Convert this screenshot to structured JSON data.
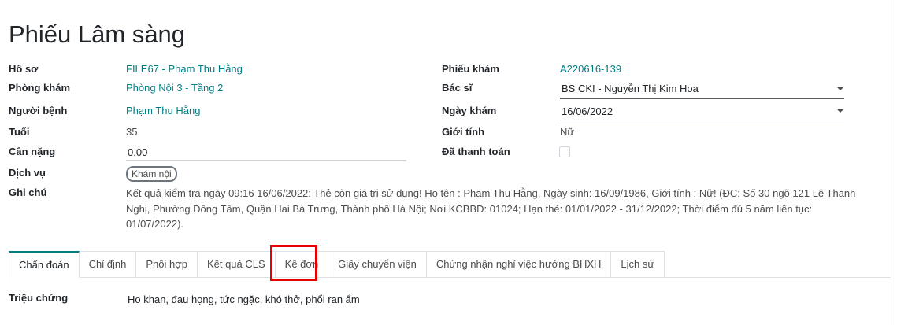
{
  "page": {
    "title": "Phiếu Lâm sàng"
  },
  "left": {
    "ho_so": {
      "label": "Hồ sơ",
      "value": "FILE67 - Phạm Thu Hằng"
    },
    "phong_kham": {
      "label": "Phòng khám",
      "value": "Phòng Nội 3 - Tầng 2"
    },
    "nguoi_benh": {
      "label": "Người bệnh",
      "value": "Phạm Thu Hằng"
    },
    "tuoi": {
      "label": "Tuổi",
      "value": "35"
    },
    "can_nang": {
      "label": "Cân nặng",
      "value": "0,00"
    },
    "dich_vu": {
      "label": "Dịch vụ",
      "tag": "Khám nội"
    },
    "ghi_chu": {
      "label": "Ghi chú",
      "value": "Kết quả kiểm tra ngày 09:16 16/06/2022: Thẻ còn giá trị sử dụng! Họ tên : Phạm Thu Hằng, Ngày sinh: 16/09/1986, Giới tính : Nữ! (ĐC: Số 30 ngõ 121 Lê Thanh Nghị, Phường Đồng Tâm, Quận Hai Bà Trưng, Thành phố Hà Nội; Nơi KCBBĐ: 01024; Hạn thẻ: 01/01/2022 - 31/12/2022; Thời điểm đủ 5 năm liên tục: 01/07/2022)."
    }
  },
  "right": {
    "phieu_kham": {
      "label": "Phiếu khám",
      "value": "A220616-139"
    },
    "bac_si": {
      "label": "Bác sĩ",
      "value": "BS CKI - Nguyễn Thị Kim Hoa"
    },
    "ngay_kham": {
      "label": "Ngày khám",
      "value": "16/06/2022"
    },
    "gioi_tinh": {
      "label": "Giới tính",
      "value": "Nữ"
    },
    "da_thanh_toan": {
      "label": "Đã thanh toán",
      "checked": false
    }
  },
  "tabs": [
    {
      "label": "Chẩn đoán",
      "active": true
    },
    {
      "label": "Chỉ định"
    },
    {
      "label": "Phối hợp"
    },
    {
      "label": "Kết quả CLS"
    },
    {
      "label": "Kê đơn",
      "highlighted": true
    },
    {
      "label": "Giấy chuyển viện"
    },
    {
      "label": "Chứng nhận nghỉ việc hưởng BHXH"
    },
    {
      "label": "Lịch sử"
    }
  ],
  "tab_content": {
    "trieu_chung": {
      "label": "Triệu chứng",
      "value": "Ho khan, đau họng, tức ngặc, khó thở, phổi ran ẩm"
    }
  },
  "colors": {
    "link": "#017e84",
    "highlight": "#e60000",
    "active_tab": "#017e84"
  }
}
